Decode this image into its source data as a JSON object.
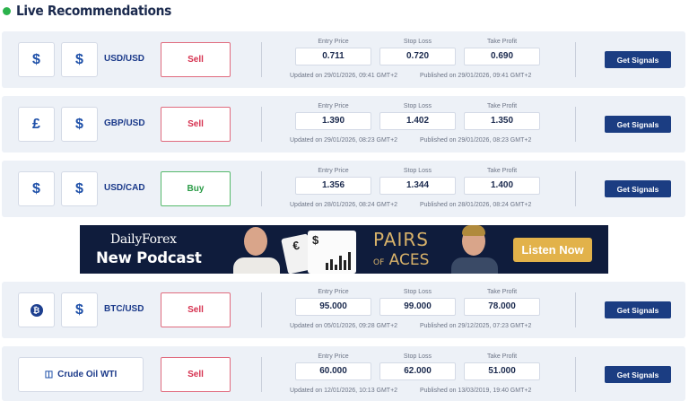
{
  "heading": {
    "title": "Live Recommendations",
    "dot_color": "#2bb24c"
  },
  "columns": {
    "entry": "Entry Price",
    "stop": "Stop Loss",
    "take": "Take Profit"
  },
  "get_signals_label": "Get Signals",
  "rows": [
    {
      "icon_a": "$",
      "icon_b": "$",
      "pair": "USD/USD",
      "action": "Sell",
      "entry": "0.711",
      "stop": "0.720",
      "take": "0.690",
      "updated": "Updated on 29/01/2026, 09:41 GMT+2",
      "published": "Published on 29/01/2026, 09:41 GMT+2"
    },
    {
      "icon_a": "£",
      "icon_b": "$",
      "pair": "GBP/USD",
      "action": "Sell",
      "entry": "1.390",
      "stop": "1.402",
      "take": "1.350",
      "updated": "Updated on 29/01/2026, 08:23 GMT+2",
      "published": "Published on 29/01/2026, 08:23 GMT+2"
    },
    {
      "icon_a": "$",
      "icon_b": "$",
      "pair": "USD/CAD",
      "action": "Buy",
      "entry": "1.356",
      "stop": "1.344",
      "take": "1.400",
      "updated": "Updated on 28/01/2026, 08:24 GMT+2",
      "published": "Published on 28/01/2026, 08:24 GMT+2"
    },
    {
      "icon_a": "₿",
      "icon_b": "$",
      "pair": "BTC/USD",
      "action": "Sell",
      "entry": "95.000",
      "stop": "99.000",
      "take": "78.000",
      "updated": "Updated on 05/01/2026, 09:28 GMT+2",
      "published": "Published on 29/12/2025, 07:23 GMT+2"
    },
    {
      "pair": "Crude Oil WTI",
      "action": "Sell",
      "entry": "60.000",
      "stop": "62.000",
      "take": "51.000",
      "updated": "Updated on 12/01/2026, 10:13 GMT+2",
      "published": "Published on 13/03/2019, 19:40 GMT+2"
    }
  ],
  "banner": {
    "brand": "DailyForex",
    "tagline": "New Podcast",
    "card_symbol_1": "€",
    "card_symbol_2": "$",
    "show_title_line1": "PAIRS",
    "show_title_of": "OF",
    "show_title_line2": "ACES",
    "cta": "Listen Now"
  }
}
